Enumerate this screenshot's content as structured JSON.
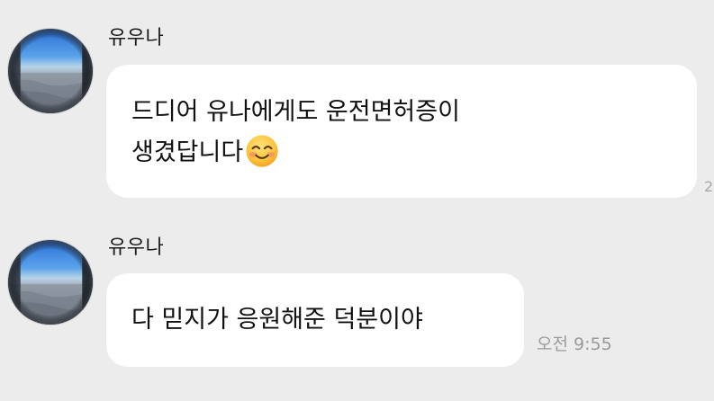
{
  "messages": [
    {
      "sender": "유우나",
      "avatar_icon": "airplane-window-sky-avatar",
      "lines": [
        "드디어 유나에게도 운전면허증이",
        "생겼답니다"
      ],
      "emoji": "smiling-face-icon"
    },
    {
      "sender": "유우나",
      "avatar_icon": "airplane-window-sky-avatar",
      "lines": [
        "다 믿지가 응원해준 덕분이야"
      ],
      "timestamp": "오전 9:55"
    }
  ],
  "edge_marker": "2",
  "colors": {
    "background": "#ececec",
    "bubble": "#ffffff",
    "timestamp": "#9a9a9a"
  }
}
